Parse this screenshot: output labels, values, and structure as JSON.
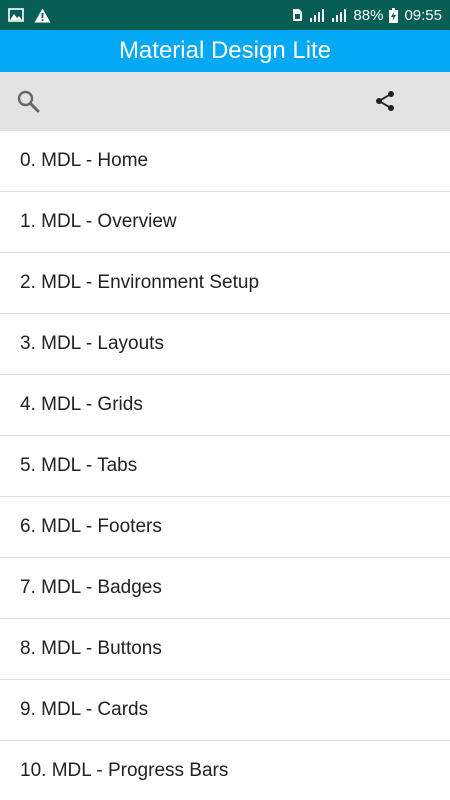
{
  "status_bar": {
    "battery": "88%",
    "time": "09:55",
    "icons": [
      "gallery-icon",
      "warning-icon",
      "sim-icon",
      "signal-icon",
      "signal-icon",
      "battery-charging-icon"
    ]
  },
  "app_bar": {
    "title": "Material Design Lite",
    "color": "#03a9f4"
  },
  "toolbar": {
    "icons": [
      "search-icon",
      "share-icon"
    ]
  },
  "list": {
    "items": [
      "0. MDL - Home",
      "1. MDL - Overview",
      "2. MDL - Environment Setup",
      "3. MDL - Layouts",
      "4. MDL - Grids",
      "5. MDL - Tabs",
      "6. MDL - Footers",
      "7. MDL - Badges",
      "8. MDL - Buttons",
      "9. MDL - Cards",
      "10. MDL - Progress Bars"
    ]
  }
}
